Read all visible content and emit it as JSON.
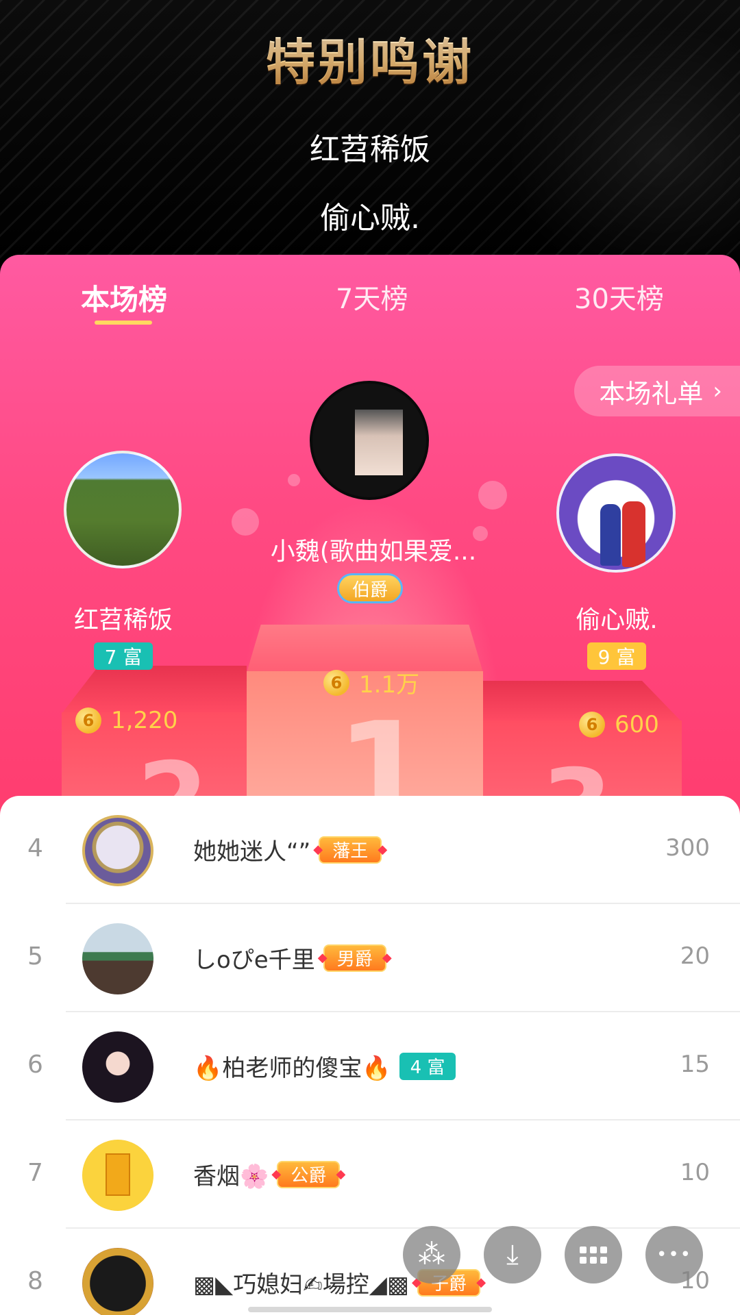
{
  "header": {
    "title": "特别鸣谢",
    "thanks": [
      "红苕稀饭",
      "偷心贼."
    ]
  },
  "tabs": [
    {
      "label": "本场榜",
      "active": true
    },
    {
      "label": "7天榜",
      "active": false
    },
    {
      "label": "30天榜",
      "active": false
    }
  ],
  "gift_list_button": {
    "label": "本场礼单",
    "chevron": "›"
  },
  "podium": {
    "first": {
      "name": "小魏(歌曲如果爱...",
      "badge": "伯爵",
      "score": "1.1万",
      "place": "1"
    },
    "second": {
      "name": "红苕稀饭",
      "badge": "7 富",
      "score": "1,220",
      "place": "2"
    },
    "third": {
      "name": "偷心贼.",
      "badge": "9 富",
      "score": "600",
      "place": "3"
    }
  },
  "coin_glyph": "6",
  "ranking": [
    {
      "rank": "4",
      "name": "她她迷人“”",
      "badge": "藩王",
      "badge_type": "noble",
      "score": "300"
    },
    {
      "rank": "5",
      "name": "しoぴe千里",
      "badge": "男爵",
      "badge_type": "noble",
      "score": "20"
    },
    {
      "rank": "6",
      "name": "🔥柏老师的傻宝🔥",
      "badge": "4 富",
      "badge_type": "teal",
      "score": "15"
    },
    {
      "rank": "7",
      "name": "香烟🌸",
      "badge": "公爵",
      "badge_type": "noble",
      "score": "10"
    },
    {
      "rank": "8",
      "name": "▩◣巧媳妇✍場控◢▩",
      "badge": "子爵",
      "badge_type": "noble",
      "score": "10"
    }
  ],
  "floating_actions": [
    {
      "icon": "share-icon",
      "glyph": "⁂"
    },
    {
      "icon": "download-icon",
      "glyph": "⤓"
    },
    {
      "icon": "grid-icon",
      "glyph": ""
    },
    {
      "icon": "more-icon",
      "glyph": "•••"
    }
  ],
  "colors": {
    "panel_pink": "#ff4a83",
    "title_gold": "#f3cf8e",
    "score_gold": "#ffd24a",
    "teal_badge": "#19c0b3",
    "tab_underline": "#ffd860"
  }
}
